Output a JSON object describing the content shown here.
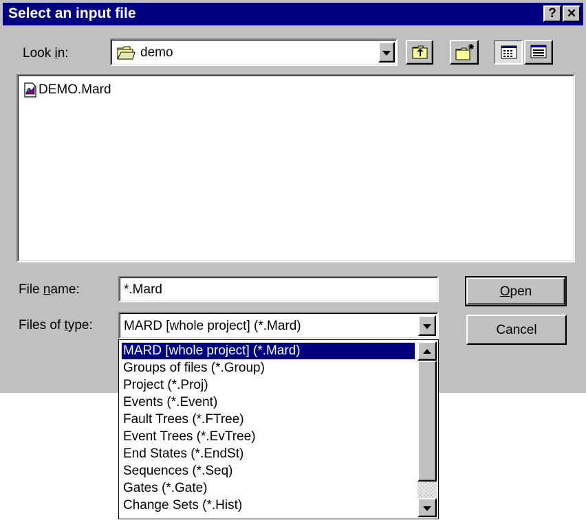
{
  "window": {
    "title": "Select an input file",
    "help_label": "?",
    "close_label": "✕"
  },
  "look_in": {
    "label_pre": "Look ",
    "label_accel": "i",
    "label_post": "n:",
    "value": "demo"
  },
  "files": [
    {
      "name": "DEMO.Mard",
      "icon": "mard-file-icon"
    }
  ],
  "file_name": {
    "label_pre": "File ",
    "label_accel": "n",
    "label_post": "ame:",
    "value": "*.Mard"
  },
  "file_type": {
    "label_pre": "Files of ",
    "label_accel": "t",
    "label_post": "ype:",
    "value": "MARD [whole project]   (*.Mard)"
  },
  "buttons": {
    "open_accel": "O",
    "open_rest": "pen",
    "cancel": "Cancel"
  },
  "type_options": [
    "MARD [whole project]   (*.Mard)",
    "Groups of files   (*.Group)",
    "Project   (*.Proj)",
    "Events   (*.Event)",
    "Fault Trees   (*.FTree)",
    "Event Trees   (*.EvTree)",
    "End States   (*.EndSt)",
    "Sequences   (*.Seq)",
    "Gates   (*.Gate)",
    "Change Sets   (*.Hist)"
  ],
  "selected_option_index": 0
}
